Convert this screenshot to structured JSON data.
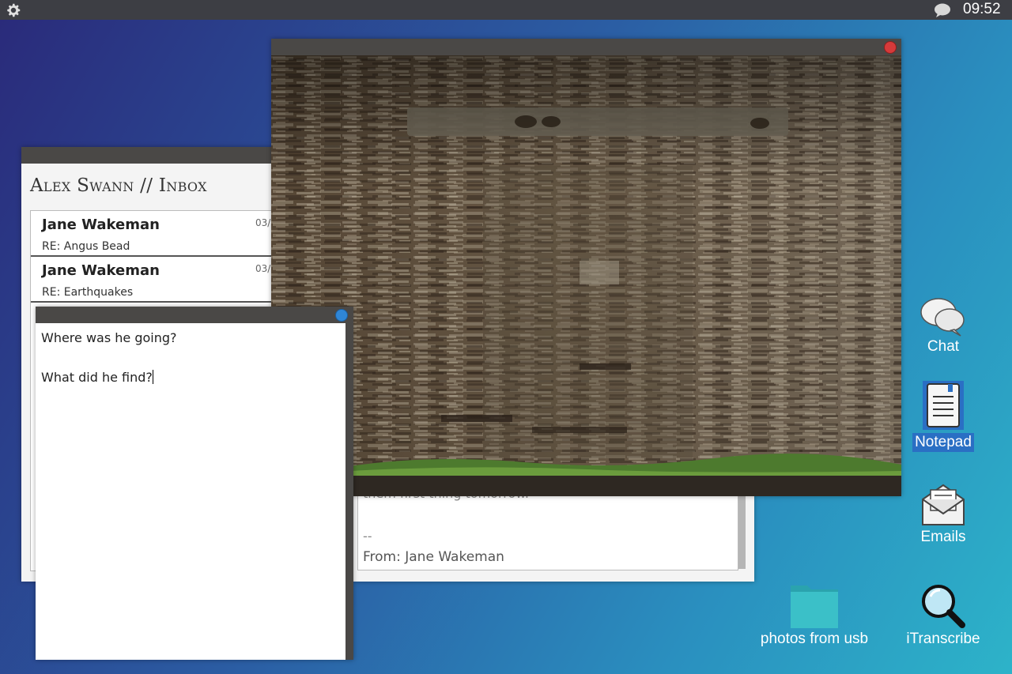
{
  "topbar": {
    "settings_icon": "gear-icon",
    "notification_icon": "chat-bubble-icon",
    "clock": "09:52"
  },
  "inbox": {
    "title": "Alex Swann // Inbox",
    "messages": [
      {
        "from": "Jane Wakeman",
        "date": "03/",
        "subject": "RE: Angus Bead"
      },
      {
        "from": "Jane Wakeman",
        "date": "03/",
        "subject": "RE: Earthquakes"
      }
    ]
  },
  "reader": {
    "cut_text": "them first thing tomorrow.",
    "signature": "--",
    "from_line": "From: Jane Wakeman"
  },
  "notepad": {
    "line1": "Where was he going?",
    "line2": "",
    "line3": "What did he find?"
  },
  "desktop": {
    "chat": "Chat",
    "notepad": "Notepad",
    "emails": "Emails",
    "folder": "photos from usb",
    "transcribe": "iTranscribe"
  },
  "colors": {
    "accent_blue": "#2a6fc4",
    "close_red": "#d63a3a",
    "titlebar": "#4a4846"
  }
}
